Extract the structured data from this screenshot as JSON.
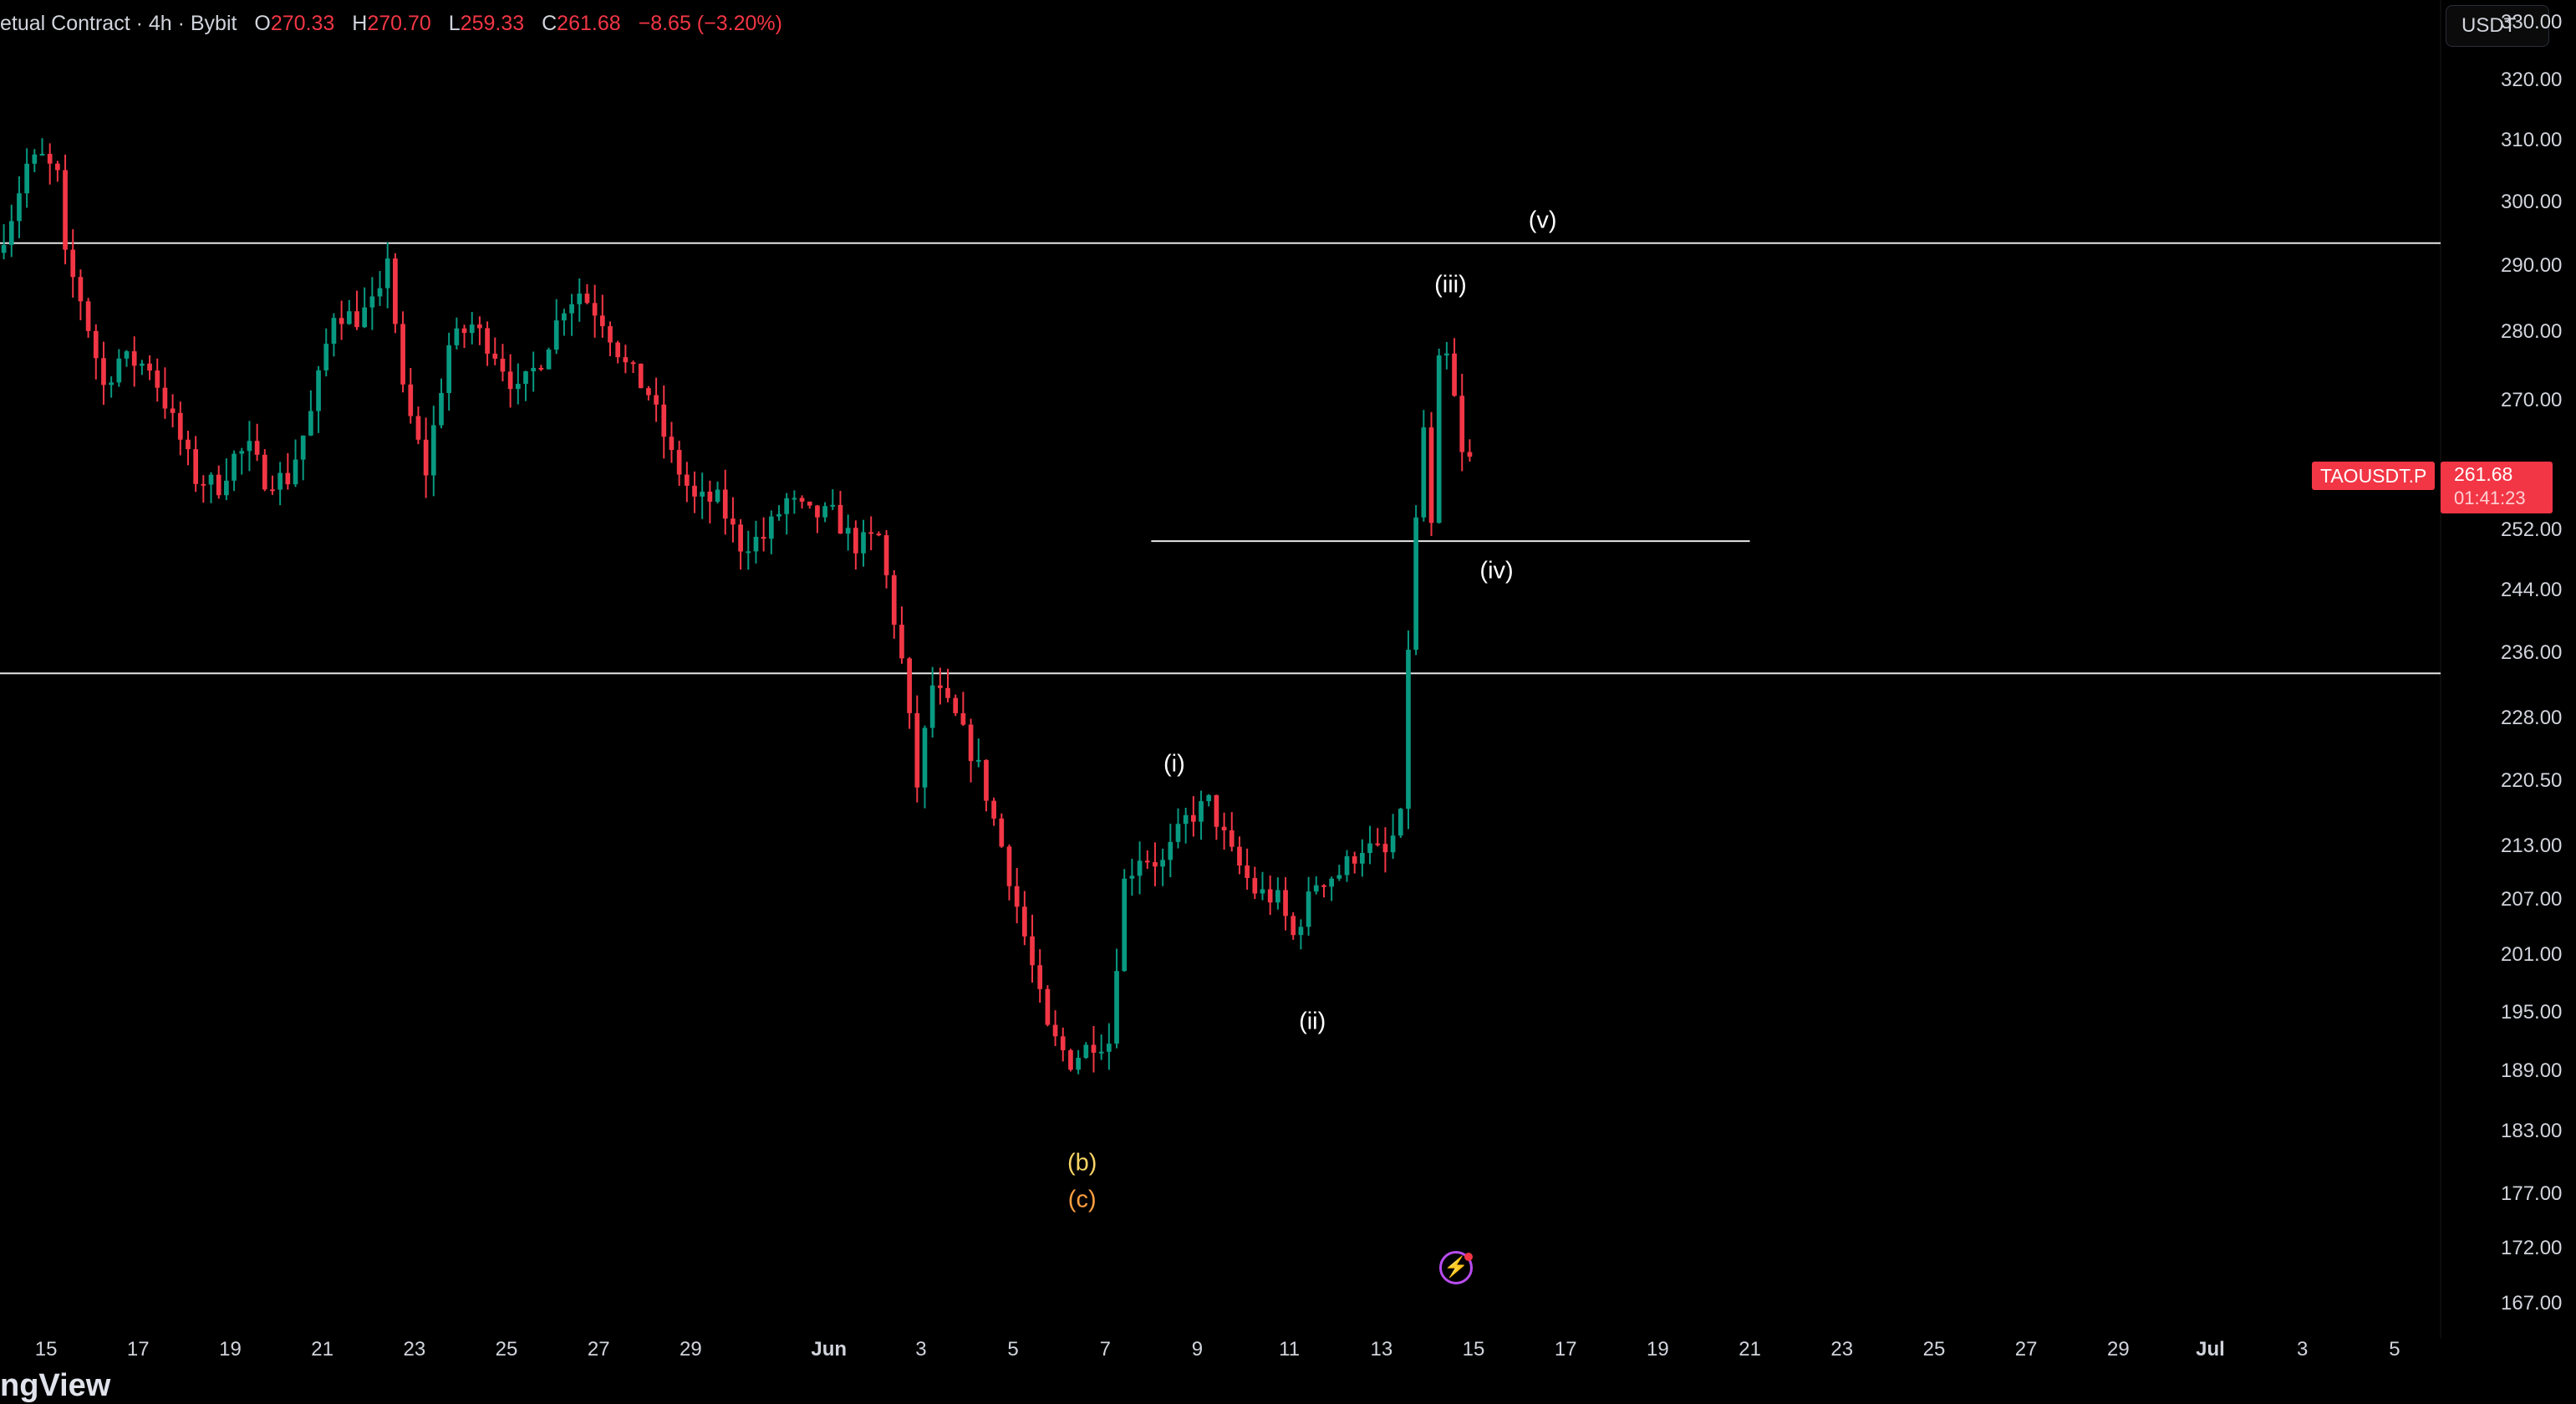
{
  "legend": {
    "title": "etual Contract · 4h · Bybit",
    "o_label": "O",
    "o_value": "270.33",
    "h_label": "H",
    "h_value": "270.70",
    "l_label": "L",
    "l_value": "259.33",
    "c_label": "C",
    "c_value": "261.68",
    "change": "−8.65 (−3.20%)"
  },
  "currency": "USDT",
  "symbol_tag": "TAOUSDT.P",
  "last_price": "261.68",
  "countdown": "01:41:23",
  "brand": "ngView",
  "colors": {
    "up": "#089981",
    "down": "#f23645",
    "background": "#000000",
    "line": "#e6e6e6"
  },
  "wave_labels": [
    "(v)",
    "(iii)",
    "(iv)",
    "(i)",
    "(ii)",
    "(b)",
    "(c)"
  ],
  "icons": [
    "lightning-icon"
  ],
  "chart_data": {
    "type": "candlestick",
    "timeframe": "4h",
    "price_ticks": [
      "330.00",
      "320.00",
      "310.00",
      "300.00",
      "290.00",
      "280.00",
      "270.00",
      "252.00",
      "244.00",
      "236.00",
      "228.00",
      "220.50",
      "213.00",
      "207.00",
      "201.00",
      "195.00",
      "189.00",
      "183.00",
      "177.00",
      "172.00",
      "167.00"
    ],
    "price_tick_values": [
      330,
      320,
      310,
      300,
      290,
      280,
      270,
      252,
      244,
      236,
      228,
      220.5,
      213,
      207,
      201,
      195,
      189,
      183,
      177,
      172,
      167
    ],
    "time_ticks": [
      "15",
      "17",
      "19",
      "21",
      "23",
      "25",
      "27",
      "29",
      "Jun",
      "3",
      "5",
      "7",
      "9",
      "11",
      "13",
      "15",
      "17",
      "19",
      "21",
      "23",
      "25",
      "27",
      "29",
      "Jul",
      "3",
      "5"
    ],
    "time_tick_dates": [
      "2024-05-15",
      "2024-05-17",
      "2024-05-19",
      "2024-05-21",
      "2024-05-23",
      "2024-05-25",
      "2024-05-27",
      "2024-05-29",
      "2024-06-01",
      "2024-06-03",
      "2024-06-05",
      "2024-06-07",
      "2024-06-09",
      "2024-06-11",
      "2024-06-13",
      "2024-06-15",
      "2024-06-17",
      "2024-06-19",
      "2024-06-21",
      "2024-06-23",
      "2024-06-25",
      "2024-06-27",
      "2024-06-29",
      "2024-07-01",
      "2024-07-03",
      "2024-07-05"
    ],
    "date_range": [
      "2024-05-14",
      "2024-07-06"
    ],
    "price_range": [
      164,
      334
    ],
    "scale": "log",
    "horizontal_lines": [
      {
        "price": 293.5,
        "from": "2024-05-14",
        "to": "2024-07-06"
      },
      {
        "price": 250.5,
        "from": "2024-06-08",
        "to": "2024-06-21"
      },
      {
        "price": 233.5,
        "from": "2024-05-14",
        "to": "2024-07-06"
      }
    ],
    "wave_label_points": [
      {
        "text": "(v)",
        "date": "2024-06-16",
        "price": 297.0,
        "kind": "w"
      },
      {
        "text": "(iii)",
        "date": "2024-06-14",
        "price": 287.0,
        "kind": "w"
      },
      {
        "text": "(iv)",
        "date": "2024-06-15",
        "price": 246.5,
        "kind": "w"
      },
      {
        "text": "(i)",
        "date": "2024-06-08",
        "price": 222.5,
        "kind": "w"
      },
      {
        "text": "(ii)",
        "date": "2024-06-11",
        "price": 194.0,
        "kind": "w"
      },
      {
        "text": "(b)",
        "date": "2024-06-06",
        "price": 180.0,
        "kind": "b"
      },
      {
        "text": "(c)",
        "date": "2024-06-06",
        "price": 176.5,
        "kind": "c"
      }
    ],
    "keypoints": [
      [
        "2024-05-14 00:00",
        292
      ],
      [
        "2024-05-14 08:00",
        298
      ],
      [
        "2024-05-14 16:00",
        306
      ],
      [
        "2024-05-15 00:00",
        307
      ],
      [
        "2024-05-15 08:00",
        304
      ],
      [
        "2024-05-15 12:00",
        291
      ],
      [
        "2024-05-15 20:00",
        285
      ],
      [
        "2024-05-16 08:00",
        272
      ],
      [
        "2024-05-16 16:00",
        276
      ],
      [
        "2024-05-17 08:00",
        275
      ],
      [
        "2024-05-17 20:00",
        267
      ],
      [
        "2024-05-18 08:00",
        259
      ],
      [
        "2024-05-18 20:00",
        258
      ],
      [
        "2024-05-19 04:00",
        262
      ],
      [
        "2024-05-19 12:00",
        263
      ],
      [
        "2024-05-19 20:00",
        259
      ],
      [
        "2024-05-20 08:00",
        259
      ],
      [
        "2024-05-20 20:00",
        268
      ],
      [
        "2024-05-21 08:00",
        283
      ],
      [
        "2024-05-21 20:00",
        282
      ],
      [
        "2024-05-22 08:00",
        285
      ],
      [
        "2024-05-22 12:00",
        292
      ],
      [
        "2024-05-22 20:00",
        271
      ],
      [
        "2024-05-23 08:00",
        260
      ],
      [
        "2024-05-23 20:00",
        278
      ],
      [
        "2024-05-24 08:00",
        281
      ],
      [
        "2024-05-24 20:00",
        277
      ],
      [
        "2024-05-25 08:00",
        271
      ],
      [
        "2024-05-25 20:00",
        276
      ],
      [
        "2024-05-26 08:00",
        284
      ],
      [
        "2024-05-26 16:00",
        286
      ],
      [
        "2024-05-27 04:00",
        282
      ],
      [
        "2024-05-27 16:00",
        275
      ],
      [
        "2024-05-28 04:00",
        271
      ],
      [
        "2024-05-28 16:00",
        262
      ],
      [
        "2024-05-29 04:00",
        256
      ],
      [
        "2024-05-29 16:00",
        256
      ],
      [
        "2024-05-30 04:00",
        250
      ],
      [
        "2024-05-30 16:00",
        251
      ],
      [
        "2024-05-31 04:00",
        256
      ],
      [
        "2024-05-31 16:00",
        254
      ],
      [
        "2024-06-01 04:00",
        254
      ],
      [
        "2024-06-01 16:00",
        250
      ],
      [
        "2024-06-02 04:00",
        251
      ],
      [
        "2024-06-02 16:00",
        235
      ],
      [
        "2024-06-03 00:00",
        220
      ],
      [
        "2024-06-03 08:00",
        232
      ],
      [
        "2024-06-03 20:00",
        228
      ],
      [
        "2024-06-04 08:00",
        222
      ],
      [
        "2024-06-04 20:00",
        213
      ],
      [
        "2024-06-05 08:00",
        203
      ],
      [
        "2024-06-05 20:00",
        193
      ],
      [
        "2024-06-06 08:00",
        190
      ],
      [
        "2024-06-06 20:00",
        192
      ],
      [
        "2024-06-07 04:00",
        192
      ],
      [
        "2024-06-07 12:00",
        209
      ],
      [
        "2024-06-07 20:00",
        212
      ],
      [
        "2024-06-08 08:00",
        211
      ],
      [
        "2024-06-08 20:00",
        216
      ],
      [
        "2024-06-09 08:00",
        218
      ],
      [
        "2024-06-09 20:00",
        212
      ],
      [
        "2024-06-10 08:00",
        208
      ],
      [
        "2024-06-10 20:00",
        207
      ],
      [
        "2024-06-11 04:00",
        203
      ],
      [
        "2024-06-11 16:00",
        209
      ],
      [
        "2024-06-12 04:00",
        210
      ],
      [
        "2024-06-12 16:00",
        213
      ],
      [
        "2024-06-13 04:00",
        212
      ],
      [
        "2024-06-13 12:00",
        216
      ],
      [
        "2024-06-13 16:00",
        237
      ],
      [
        "2024-06-13 20:00",
        253
      ],
      [
        "2024-06-14 00:00",
        266
      ],
      [
        "2024-06-14 04:00",
        252
      ],
      [
        "2024-06-14 08:00",
        275
      ],
      [
        "2024-06-14 12:00",
        276
      ],
      [
        "2024-06-14 16:00",
        270
      ],
      [
        "2024-06-14 20:00",
        262
      ]
    ]
  }
}
